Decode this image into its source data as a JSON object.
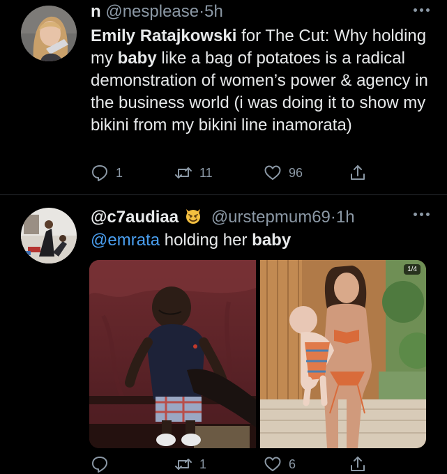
{
  "tweets": [
    {
      "name": "n",
      "handle": "@nesplease",
      "separator": "·",
      "time": "5h",
      "body": {
        "part1": "Emily Ratajkowski",
        "part2": " for The Cut: Why holding my ",
        "bold": "baby",
        "part3": " like a bag of potatoes is a radical demonstration of women’s power & agency in the business world (i was doing it to show my bikini from my bikini line inamorata)"
      },
      "actions": {
        "replies": "1",
        "retweets": "11",
        "likes": "96"
      }
    },
    {
      "name": "@c7audiaa",
      "emoji": "smiling-imp",
      "handle": "@urstepmum69",
      "separator": "·",
      "time": "1h",
      "body": {
        "mention": "@emrata",
        "part1": " holding her ",
        "bold": "baby"
      },
      "media": {
        "badge": "1/4",
        "photos": [
          "baby-held-by-hand-photo",
          "woman-in-bikini-holding-baby-photo"
        ]
      },
      "actions": {
        "replies": "",
        "retweets": "1",
        "likes": "6"
      }
    }
  ],
  "colors": {
    "background": "#000000",
    "text": "#e7e9ea",
    "muted": "#8b98a5",
    "link": "#4a9ff0",
    "divider": "#2a2d31"
  }
}
